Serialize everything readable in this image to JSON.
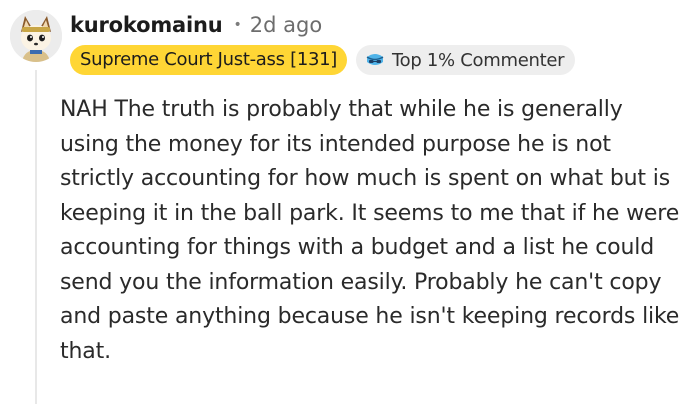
{
  "comment": {
    "username": "kurokomainu",
    "separator": "•",
    "time": "2d ago",
    "flair": "Supreme Court Just-ass [131]",
    "achievement": {
      "label": "Top 1% Commenter",
      "icon": "top-commenter-icon"
    },
    "avatar": "avatar-icon",
    "body": "NAH The truth is probably that while he is generally using the money for its intended purpose he is not strictly accounting for how much is spent on what but is keeping it in the ball park. It seems to me that if he were accounting for things with a budget and a list he could send you the information easily. Probably he can't copy and paste anything because he isn't keeping records like that."
  },
  "colors": {
    "flair_bg": "#ffd635",
    "badge_bg": "#eeeeee",
    "thread_line": "#e8e8e8",
    "text": "#2a2a2a",
    "muted": "#6d6d6d"
  }
}
